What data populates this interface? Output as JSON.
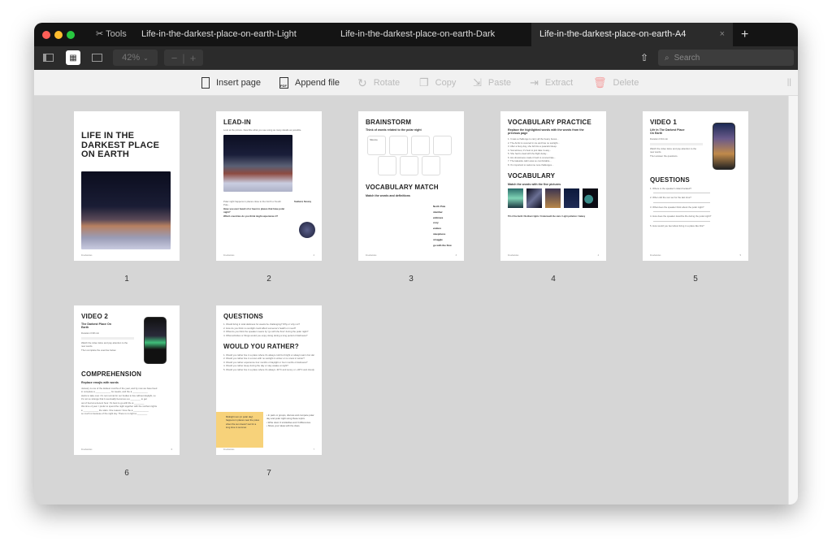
{
  "tabs": {
    "tools_label": "Tools",
    "items": [
      {
        "label": "Life-in-the-darkest-place-on-earth-Light"
      },
      {
        "label": "Life-in-the-darkest-place-on-earth-Dark"
      },
      {
        "label": "Life-in-the-darkest-place-on-earth-A4",
        "active": true
      }
    ],
    "close": "×",
    "new_tab": "+"
  },
  "toolbar": {
    "zoom": "42%",
    "zoom_out": "−",
    "zoom_in": "+",
    "search_placeholder": "Search"
  },
  "actions": {
    "insert": "Insert page",
    "append": "Append file",
    "rotate": "Rotate",
    "copy": "Copy",
    "paste": "Paste",
    "extract": "Extract",
    "delete": "Delete"
  },
  "colors": {
    "accent_yellow": "#f7d27a",
    "delete_red": "#f4a3a3",
    "window_bg": "#d6d6d6"
  },
  "pages": [
    {
      "number": "1",
      "title": "LIFE IN THE DARKEST PLACE ON EARTH"
    },
    {
      "number": "2",
      "title": "LEAD-IN",
      "sub": "Look at the picture. Describe what you see using as many details as possible.",
      "location": "Svalbard, Norway",
      "bullets": [
        "Have you ever heard of or been to places that have polar night?",
        "Which countries do you think might experience it?"
      ]
    },
    {
      "number": "3",
      "title": "BRAINSTORM",
      "sub": "Think of words related to the polar night",
      "hex_label": "Silence",
      "title2": "VOCABULARY MATCH",
      "sub2": "Match the words and definitions",
      "words": [
        "North Pole",
        "slumber",
        "embrace",
        "cozy",
        "endure",
        "sleepiness",
        "struggle",
        "go with the flow"
      ]
    },
    {
      "number": "4",
      "title": "VOCABULARY PRACTICE",
      "sub": "Replace the highlighted words with the words from the previous page",
      "title2": "VOCABULARY",
      "sub2": "Match the words with the five pictures",
      "options": "Tilt of the Earth / Northern lights / Underneath the stars / Light pollution / Galaxy"
    },
    {
      "number": "5",
      "title": "VIDEO 1",
      "sub": "Life In The Darkest Place On Earth",
      "duration": "Duration 0:34 min",
      "steps": [
        "Watch the video twice and pay attention to the new words.",
        "Then answer the questions."
      ],
      "title2": "QUESTIONS"
    },
    {
      "number": "6",
      "title": "VIDEO 2",
      "sub": "The Darkest Place On Earth",
      "duration": "Duration 0:38 min",
      "steps": [
        "Watch the video twice and pay attention to the new words.",
        "Then complete the exercise below."
      ],
      "title2": "COMPREHENSION",
      "sub2": "Replace emojis with words"
    },
    {
      "number": "7",
      "title": "QUESTIONS",
      "title2": "WOULD YOU RATHER?",
      "note": "Midnight sun (or polar day) happens in places near the poles when the sun doesn't set for a long time in summer."
    }
  ]
}
